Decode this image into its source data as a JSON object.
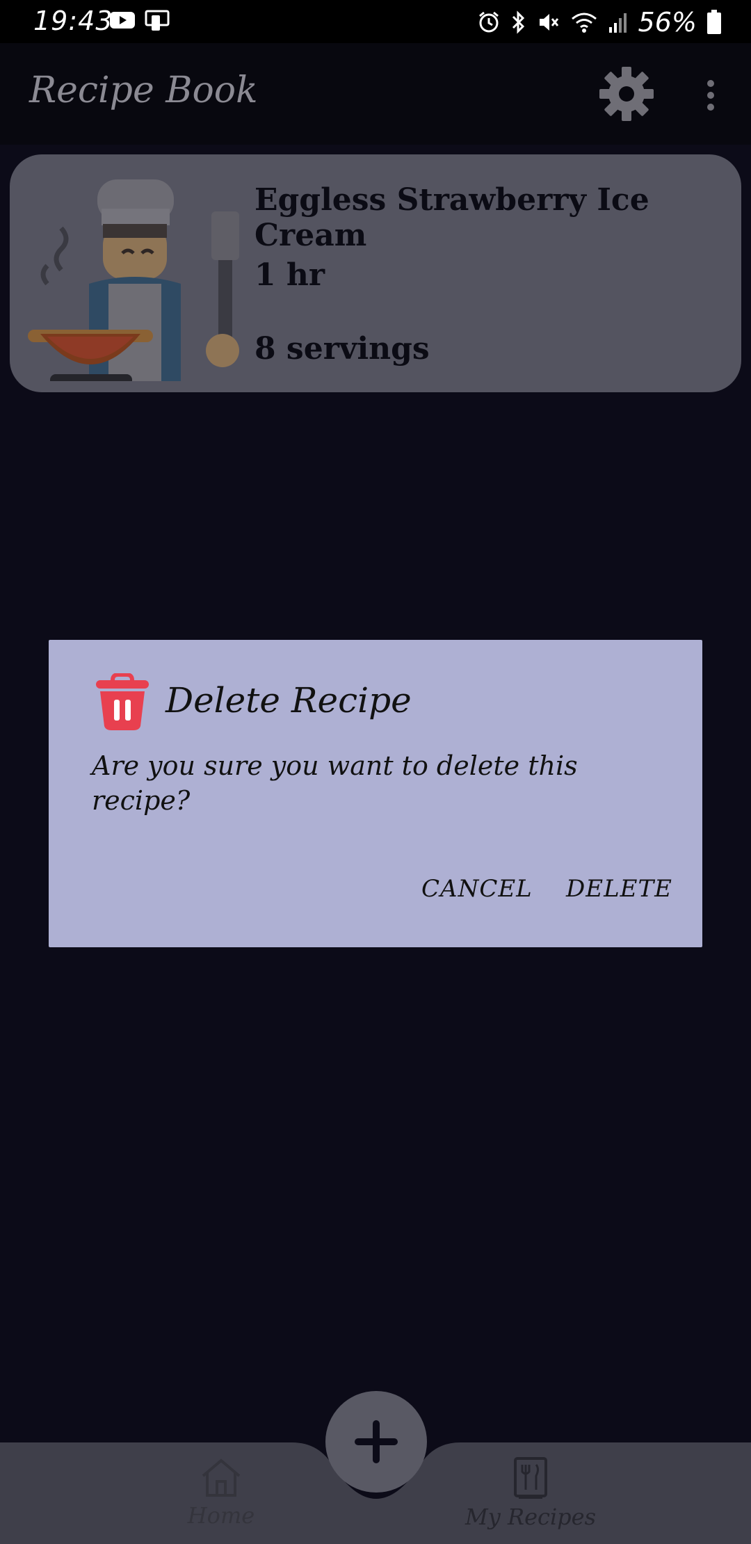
{
  "status_bar": {
    "time": "19:43",
    "battery_percent": "56%"
  },
  "app_bar": {
    "title": "Recipe Book"
  },
  "recipe_card": {
    "title": "Eggless Strawberry Ice Cream",
    "time": "1 hr",
    "servings": "8 servings"
  },
  "dialog": {
    "title": "Delete Recipe",
    "message": "Are you sure you want to delete this recipe?",
    "cancel_label": "CANCEL",
    "delete_label": "DELETE"
  },
  "bottom_nav": {
    "home_label": "Home",
    "recipes_label": "My Recipes"
  },
  "colors": {
    "dialog_bg": "#aeb0d3",
    "delete_icon": "#e8404f",
    "card_bg": "#545460"
  }
}
